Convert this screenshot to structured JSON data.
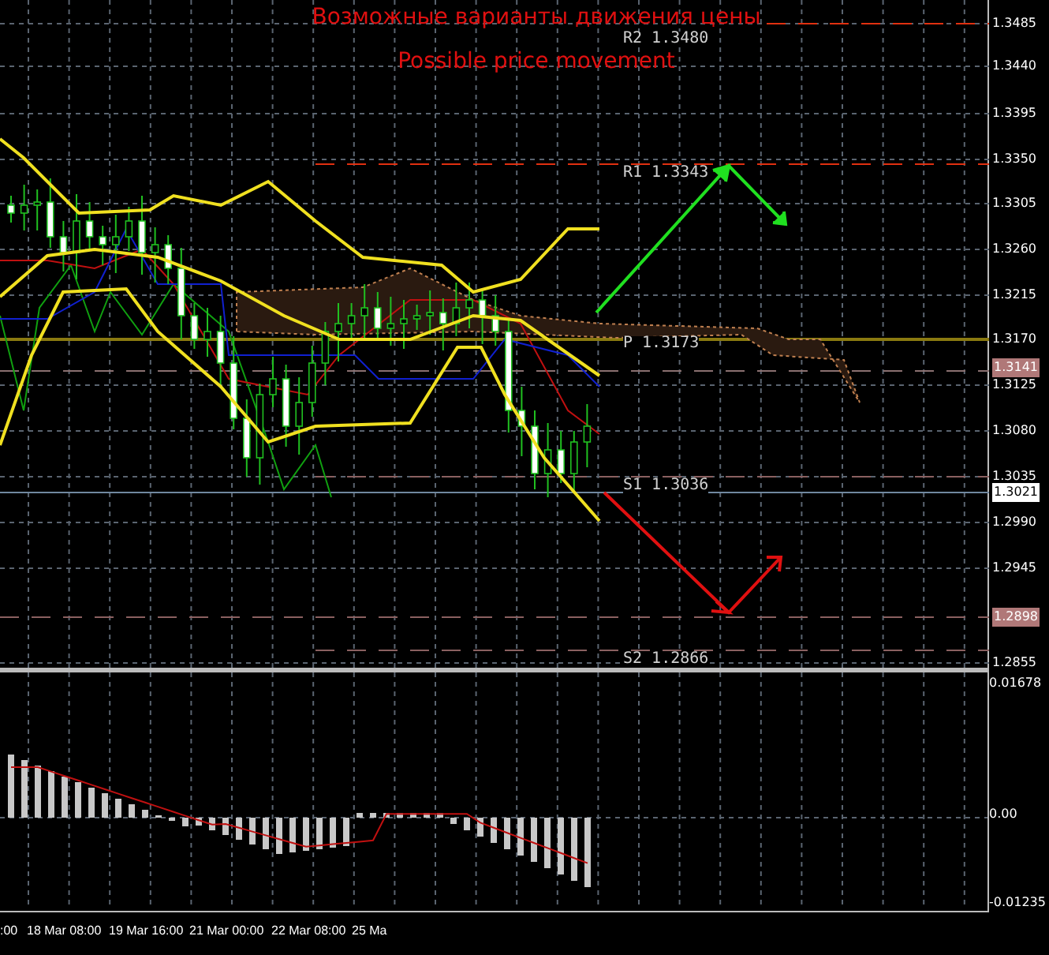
{
  "title": {
    "line_1": "Возможные варианты движения цены",
    "line_2": "Possible price movement"
  },
  "pivot_levels": [
    {
      "label": "R2 1.3480"
    },
    {
      "label": "R1 1.3343"
    },
    {
      "label": "P 1.3173"
    },
    {
      "label": "S1 1.3036"
    },
    {
      "label": "S2 1.2866"
    }
  ],
  "price_axis": {
    "ticks": [
      "1.3485",
      "1.3440",
      "1.3395",
      "1.3350",
      "1.3305",
      "1.3260",
      "1.3215",
      "1.3170",
      "1.3125",
      "1.3080",
      "1.3035",
      "1.2990",
      "1.2945",
      "1.2855"
    ],
    "badges": [
      {
        "text": "1.3141",
        "kind": "marker"
      },
      {
        "text": "1.3021",
        "kind": "current"
      },
      {
        "text": "1.2898",
        "kind": "marker"
      }
    ]
  },
  "indicator_axis": {
    "ticks": [
      "0.01678",
      "0.00",
      "-0.01235"
    ]
  },
  "time_axis": {
    "labels": [
      ":00",
      "18 Mar 08:00",
      "19 Mar 16:00",
      "21 Mar 00:00",
      "22 Mar 08:00",
      "25 Ma"
    ]
  }
}
